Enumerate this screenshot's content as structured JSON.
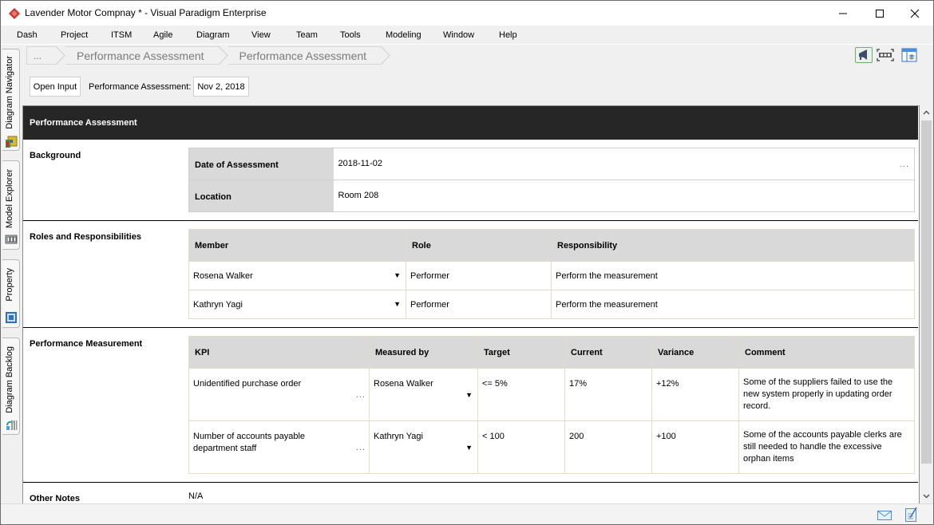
{
  "window": {
    "title": "Lavender Motor Compnay * - Visual Paradigm Enterprise",
    "controls": [
      "minimize",
      "maximize",
      "close"
    ]
  },
  "menu": [
    "Dash",
    "Project",
    "ITSM",
    "Agile",
    "Diagram",
    "View",
    "Team",
    "Tools",
    "Modeling",
    "Window",
    "Help"
  ],
  "dock_tabs": [
    "Diagram Navigator",
    "Model Explorer",
    "Property",
    "Diagram Backlog"
  ],
  "breadcrumb": [
    "...",
    "Performance Assessment",
    "Performance Assessment"
  ],
  "toolbar_icons": [
    "announcement-icon",
    "fit-screen-icon",
    "layers-panel-icon"
  ],
  "input_row": {
    "open_input_label": "Open Input",
    "assessment_label": "Performance Assessment:",
    "assessment_date": "Nov 2, 2018"
  },
  "document": {
    "title": "Performance Assessment",
    "background": {
      "title": "Background",
      "rows": [
        {
          "key": "Date of Assessment",
          "value": "2018-11-02"
        },
        {
          "key": "Location",
          "value": "Room 208"
        }
      ]
    },
    "roles": {
      "title": "Roles and Responsibilities",
      "headers": [
        "Member",
        "Role",
        "Responsibility"
      ],
      "rows": [
        {
          "member": "Rosena Walker",
          "role": "Performer",
          "responsibility": "Perform the measurement"
        },
        {
          "member": "Kathryn Yagi",
          "role": "Performer",
          "responsibility": "Perform the measurement"
        }
      ]
    },
    "measurement": {
      "title": "Performance Measurement",
      "headers": [
        "KPI",
        "Measured by",
        "Target",
        "Current",
        "Variance",
        "Comment"
      ],
      "rows": [
        {
          "kpi": "Unidentified purchase order",
          "measured_by": "Rosena Walker",
          "target": "<= 5%",
          "current": "17%",
          "variance": "+12%",
          "comment": "Some of the suppliers failed to use the new system properly in updating order record."
        },
        {
          "kpi": "Number of accounts payable department staff",
          "measured_by": "Kathryn Yagi",
          "target": "< 100",
          "current": "200",
          "variance": "+100",
          "comment": "Some of the accounts payable clerks are still needed to handle the excessive orphan items"
        }
      ]
    },
    "other_notes": {
      "title": "Other Notes",
      "value": "N/A"
    }
  },
  "ellipsis": "...",
  "dropdown_arrow": "▼",
  "colors": {
    "header_bg": "#262626",
    "table_header_bg": "#d9d9d9",
    "logo": "#c9342f"
  }
}
